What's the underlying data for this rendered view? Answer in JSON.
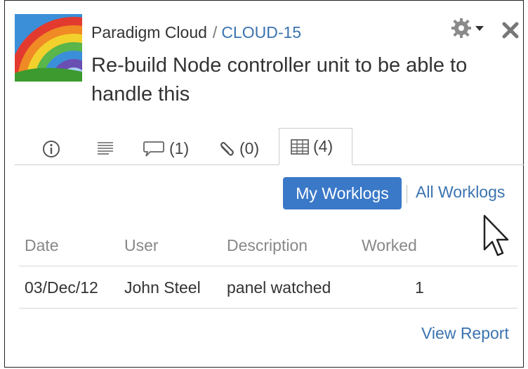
{
  "header": {
    "project_name": "Paradigm Cloud",
    "separator": "/",
    "issue_key": "CLOUD-15",
    "summary": "Re-build Node controller unit to be able to handle this"
  },
  "tabs": [
    {
      "icon": "info-icon",
      "label": ""
    },
    {
      "icon": "description-icon",
      "label": ""
    },
    {
      "icon": "comment-icon",
      "label": "(1)"
    },
    {
      "icon": "attachment-icon",
      "label": "(0)"
    },
    {
      "icon": "worklog-table-icon",
      "label": "(4)",
      "active": true
    }
  ],
  "worklog_filter": {
    "mine_label": "My Worklogs",
    "all_label": "All Worklogs",
    "selected": "My Worklogs"
  },
  "table": {
    "columns": [
      "Date",
      "User",
      "Description",
      "Worked"
    ],
    "rows": [
      {
        "date": "03/Dec/12",
        "user": "John Steel",
        "description": "panel watched",
        "worked": "1"
      }
    ]
  },
  "footer": {
    "view_report": "View Report"
  },
  "colors": {
    "accent": "#3a78c8",
    "link": "#3b73af"
  }
}
